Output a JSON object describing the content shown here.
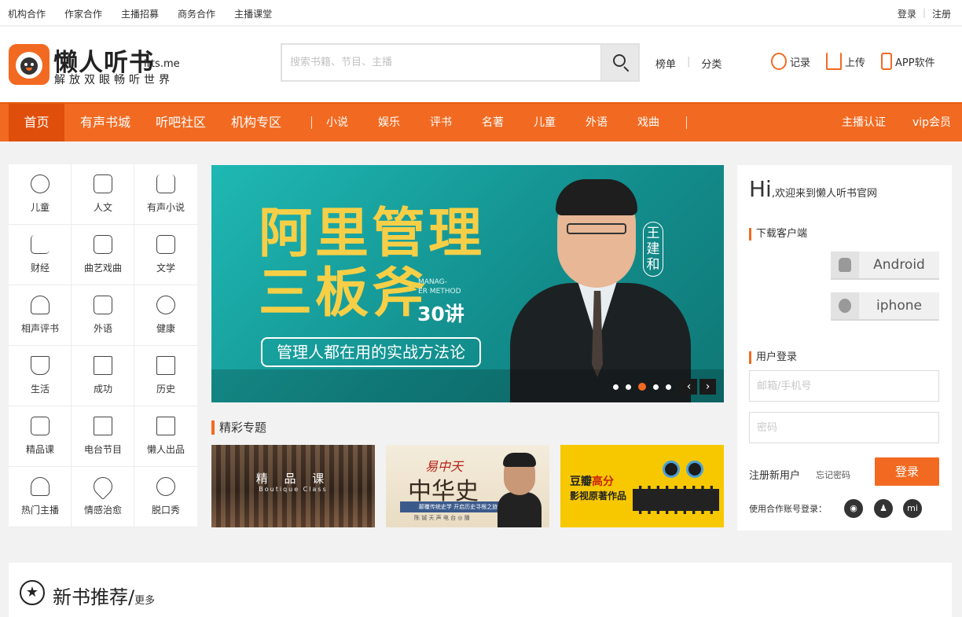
{
  "topbar": {
    "links": [
      "机构合作",
      "作家合作",
      "主播招募",
      "商务合作",
      "主播课堂"
    ],
    "login": "登录",
    "register": "注册"
  },
  "header": {
    "logo_name": "懒人听书",
    "logo_domain": "lrts.me",
    "slogan": "解放双眼畅听世界",
    "search_placeholder": "搜索书籍、节目、主播",
    "quick_links": [
      "榜单",
      "分类"
    ],
    "tools": [
      {
        "label": "记录",
        "icon": "clock-icon"
      },
      {
        "label": "上传",
        "icon": "upload-icon"
      },
      {
        "label": "APP软件",
        "icon": "phone-icon"
      }
    ]
  },
  "nav": {
    "home": "首页",
    "main": [
      "有声书城",
      "听吧社区",
      "机构专区"
    ],
    "categories": [
      "小说",
      "娱乐",
      "评书",
      "名著",
      "儿童",
      "外语",
      "戏曲"
    ],
    "right": [
      "主播认证",
      "vip会员"
    ]
  },
  "categories": [
    {
      "label": "儿童",
      "icon": "baby-icon"
    },
    {
      "label": "人文",
      "icon": "building-icon"
    },
    {
      "label": "有声小说",
      "icon": "glasses-icon"
    },
    {
      "label": "财经",
      "icon": "chart-icon"
    },
    {
      "label": "曲艺戏曲",
      "icon": "disc-icon"
    },
    {
      "label": "文学",
      "icon": "book-icon"
    },
    {
      "label": "相声评书",
      "icon": "fan-icon"
    },
    {
      "label": "外语",
      "icon": "abc-icon"
    },
    {
      "label": "健康",
      "icon": "pill-icon"
    },
    {
      "label": "生活",
      "icon": "cup-icon"
    },
    {
      "label": "成功",
      "icon": "ruler-icon"
    },
    {
      "label": "历史",
      "icon": "scroll-icon"
    },
    {
      "label": "精品课",
      "icon": "play-book-icon"
    },
    {
      "label": "电台节目",
      "icon": "radio-icon"
    },
    {
      "label": "懒人出品",
      "icon": "lazy-badge-icon"
    },
    {
      "label": "热门主播",
      "icon": "people-icon"
    },
    {
      "label": "情感治愈",
      "icon": "heart-icon"
    },
    {
      "label": "脱口秀",
      "icon": "mic-icon"
    }
  ],
  "banner": {
    "title_line1": "阿里管理",
    "title_line2": "三板斧",
    "english": "MANAG-\nER METHOD",
    "episodes": "30讲",
    "tagline": "管理人都在用的实战方法论",
    "speaker": "王建和",
    "active_slide": 3,
    "slide_count": 5
  },
  "topics": {
    "title": "精彩专题",
    "items": [
      {
        "title": "精 品 课",
        "subtitle": "Boutique Class"
      },
      {
        "brand": "易中天",
        "title": "中华史",
        "band": "颠覆传统史学 开启历史寻根之旅",
        "sub": "陈 铖 天 声   电 台 ◎ 播"
      },
      {
        "line1_a": "豆瓣",
        "line1_b": "高分",
        "line2": "影视原著作品"
      }
    ]
  },
  "login_panel": {
    "hi": "Hi",
    "welcome": ",欢迎来到懒人听书官网",
    "download_title": "下载客户端",
    "android": "Android",
    "iphone": "iphone",
    "login_title": "用户登录",
    "email_placeholder": "邮箱/手机号",
    "password_placeholder": "密码",
    "register": "注册新用户",
    "forgot": "忘记密码",
    "login_button": "登录",
    "partner_login": "使用合作账号登录：",
    "social": [
      "weibo-icon",
      "qq-icon",
      "xiaomi-icon"
    ],
    "xiaomi_label": "mi"
  },
  "new_books": {
    "title": "新书推荐/",
    "more": "更多"
  },
  "colors": {
    "brand_orange": "#f26a21",
    "nav_active": "#e04e0b",
    "banner_teal": "#13908f",
    "banner_yellow": "#f6cf47"
  }
}
